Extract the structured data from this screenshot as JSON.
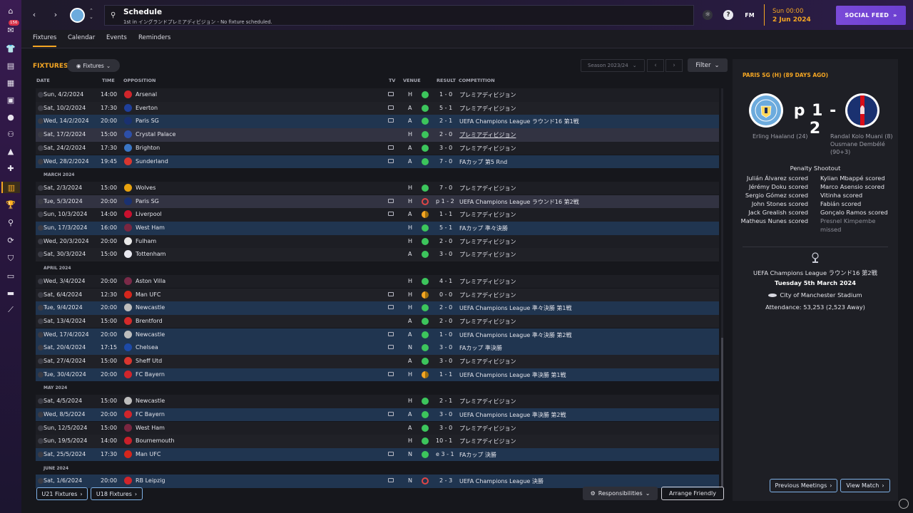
{
  "sidebar": {
    "badge_count": "156",
    "icons": [
      "home-icon",
      "inbox-icon",
      "squad-icon",
      "clipboard-icon",
      "report-icon",
      "coach-icon",
      "staff-icon",
      "training-icon",
      "medical-icon",
      "schedule-icon",
      "trophy-icon",
      "scouting-icon",
      "transfers-icon",
      "club-vision-icon",
      "finances-icon",
      "dev-centre-icon",
      "data-hub-icon"
    ]
  },
  "header": {
    "title": "Schedule",
    "subtitle": "1st in イングランドプレミアディビジョン - No fixture scheduled.",
    "game_time": "Sun 00:00",
    "game_date": "2 Jun 2024",
    "social_feed_label": "SOCIAL FEED",
    "fm_label": "FM"
  },
  "tabs": [
    "Fixtures",
    "Calendar",
    "Events",
    "Reminders"
  ],
  "fixtures": {
    "heading": "FIXTURES",
    "view_dropdown": "Fixtures",
    "season": "Season 2023/24",
    "filter_label": "Filter",
    "columns": {
      "date": "DATE",
      "time": "TIME",
      "opposition": "OPPOSITION",
      "tv": "TV",
      "venue": "VENUE",
      "result": "RESULT",
      "competition": "COMPETITION"
    },
    "rows": [
      {
        "kind": "match",
        "date": "Sun, 4/2/2024",
        "time": "14:00",
        "opp": "Arsenal",
        "crest": "#d0252b",
        "tv": true,
        "venue": "H",
        "res": "W",
        "score": "1 - 0",
        "comp": "プレミアディビジョン",
        "style": "even"
      },
      {
        "kind": "match",
        "date": "Sat, 10/2/2024",
        "time": "17:30",
        "opp": "Everton",
        "crest": "#1f3f9a",
        "tv": true,
        "venue": "A",
        "res": "W",
        "score": "5 - 1",
        "comp": "プレミアディビジョン",
        "style": "odd"
      },
      {
        "kind": "match",
        "date": "Wed, 14/2/2024",
        "time": "20:00",
        "opp": "Paris SG",
        "crest": "#1a3170",
        "tv": true,
        "venue": "A",
        "res": "W",
        "score": "2 - 1",
        "comp": "UEFA Champions League ラウンド16 第1戦",
        "style": "hl"
      },
      {
        "kind": "match",
        "date": "Sat, 17/2/2024",
        "time": "15:00",
        "opp": "Crystal Palace",
        "crest": "#2d4fa8",
        "tv": false,
        "venue": "H",
        "res": "W",
        "score": "2 - 0",
        "comp": "プレミアディビジョン",
        "style": "sel",
        "underline": true
      },
      {
        "kind": "match",
        "date": "Sat, 24/2/2024",
        "time": "17:30",
        "opp": "Brighton",
        "crest": "#3a75c4",
        "tv": true,
        "venue": "A",
        "res": "W",
        "score": "3 - 0",
        "comp": "プレミアディビジョン",
        "style": "even"
      },
      {
        "kind": "match",
        "date": "Wed, 28/2/2024",
        "time": "19:45",
        "opp": "Sunderland",
        "crest": "#d9362f",
        "tv": true,
        "venue": "A",
        "res": "W",
        "score": "7 - 0",
        "comp": "FAカップ 第5 Rnd",
        "style": "hl"
      },
      {
        "kind": "month",
        "label": "MARCH 2024"
      },
      {
        "kind": "match",
        "date": "Sat, 2/3/2024",
        "time": "15:00",
        "opp": "Wolves",
        "crest": "#e8a20e",
        "tv": false,
        "venue": "H",
        "res": "W",
        "score": "7 - 0",
        "comp": "プレミアディビジョン",
        "style": "even"
      },
      {
        "kind": "match",
        "date": "Tue, 5/3/2024",
        "time": "20:00",
        "opp": "Paris SG",
        "crest": "#1a3170",
        "tv": true,
        "venue": "H",
        "res": "L",
        "score": "p 1 - 2",
        "comp": "UEFA Champions League ラウンド16 第2戦",
        "style": "sel"
      },
      {
        "kind": "match",
        "date": "Sun, 10/3/2024",
        "time": "14:00",
        "opp": "Liverpool",
        "crest": "#c8102e",
        "tv": true,
        "venue": "A",
        "res": "D",
        "score": "1 - 1",
        "comp": "プレミアディビジョン",
        "style": "even"
      },
      {
        "kind": "match",
        "date": "Sun, 17/3/2024",
        "time": "16:00",
        "opp": "West Ham",
        "crest": "#7a2640",
        "tv": false,
        "venue": "H",
        "res": "W",
        "score": "5 - 1",
        "comp": "FAカップ 準々決勝",
        "style": "hl"
      },
      {
        "kind": "match",
        "date": "Wed, 20/3/2024",
        "time": "20:00",
        "opp": "Fulham",
        "crest": "#e8e8e8",
        "tv": false,
        "venue": "H",
        "res": "W",
        "score": "2 - 0",
        "comp": "プレミアディビジョン",
        "style": "even"
      },
      {
        "kind": "match",
        "date": "Sat, 30/3/2024",
        "time": "15:00",
        "opp": "Tottenham",
        "crest": "#e8e8f0",
        "tv": false,
        "venue": "A",
        "res": "W",
        "score": "3 - 0",
        "comp": "プレミアディビジョン",
        "style": "odd"
      },
      {
        "kind": "month",
        "label": "APRIL 2024"
      },
      {
        "kind": "match",
        "date": "Wed, 3/4/2024",
        "time": "20:00",
        "opp": "Aston Villa",
        "crest": "#7a2a48",
        "tv": false,
        "venue": "H",
        "res": "W",
        "score": "4 - 1",
        "comp": "プレミアディビジョン",
        "style": "even"
      },
      {
        "kind": "match",
        "date": "Sat, 6/4/2024",
        "time": "12:30",
        "opp": "Man UFC",
        "crest": "#d4261c",
        "tv": true,
        "venue": "H",
        "res": "D",
        "score": "0 - 0",
        "comp": "プレミアディビジョン",
        "style": "odd"
      },
      {
        "kind": "match",
        "date": "Tue, 9/4/2024",
        "time": "20:00",
        "opp": "Newcastle",
        "crest": "#bdbdbd",
        "tv": true,
        "venue": "H",
        "res": "W",
        "score": "2 - 0",
        "comp": "UEFA Champions League 準々決勝 第1戦",
        "style": "hl"
      },
      {
        "kind": "match",
        "date": "Sat, 13/4/2024",
        "time": "15:00",
        "opp": "Brentford",
        "crest": "#d42a2a",
        "tv": false,
        "venue": "A",
        "res": "W",
        "score": "2 - 0",
        "comp": "プレミアディビジョン",
        "style": "odd"
      },
      {
        "kind": "match",
        "date": "Wed, 17/4/2024",
        "time": "20:00",
        "opp": "Newcastle",
        "crest": "#bdbdbd",
        "tv": true,
        "venue": "A",
        "res": "W",
        "score": "1 - 0",
        "comp": "UEFA Champions League 準々決勝 第2戦",
        "style": "hl"
      },
      {
        "kind": "match",
        "date": "Sat, 20/4/2024",
        "time": "17:15",
        "opp": "Chelsea",
        "crest": "#1d4aa8",
        "tv": true,
        "venue": "N",
        "res": "W",
        "score": "3 - 0",
        "comp": "FAカップ 準決勝",
        "style": "hl"
      },
      {
        "kind": "match",
        "date": "Sat, 27/4/2024",
        "time": "15:00",
        "opp": "Sheff Utd",
        "crest": "#d9362f",
        "tv": false,
        "venue": "A",
        "res": "W",
        "score": "3 - 0",
        "comp": "プレミアディビジョン",
        "style": "odd"
      },
      {
        "kind": "match",
        "date": "Tue, 30/4/2024",
        "time": "20:00",
        "opp": "FC Bayern",
        "crest": "#d0252b",
        "tv": true,
        "venue": "H",
        "res": "D",
        "score": "1 - 1",
        "comp": "UEFA Champions League 準決勝 第1戦",
        "style": "hl"
      },
      {
        "kind": "month",
        "label": "MAY 2024"
      },
      {
        "kind": "match",
        "date": "Sat, 4/5/2024",
        "time": "15:00",
        "opp": "Newcastle",
        "crest": "#bdbdbd",
        "tv": false,
        "venue": "H",
        "res": "W",
        "score": "2 - 1",
        "comp": "プレミアディビジョン",
        "style": "even"
      },
      {
        "kind": "match",
        "date": "Wed, 8/5/2024",
        "time": "20:00",
        "opp": "FC Bayern",
        "crest": "#d0252b",
        "tv": true,
        "venue": "A",
        "res": "W",
        "score": "3 - 0",
        "comp": "UEFA Champions League 準決勝 第2戦",
        "style": "hl"
      },
      {
        "kind": "match",
        "date": "Sun, 12/5/2024",
        "time": "15:00",
        "opp": "West Ham",
        "crest": "#7a2640",
        "tv": false,
        "venue": "A",
        "res": "W",
        "score": "3 - 0",
        "comp": "プレミアディビジョン",
        "style": "even"
      },
      {
        "kind": "match",
        "date": "Sun, 19/5/2024",
        "time": "14:00",
        "opp": "Bournemouth",
        "crest": "#c8202a",
        "tv": false,
        "venue": "H",
        "res": "W",
        "score": "10 - 1",
        "comp": "プレミアディビジョン",
        "style": "odd"
      },
      {
        "kind": "match",
        "date": "Sat, 25/5/2024",
        "time": "17:30",
        "opp": "Man UFC",
        "crest": "#d4261c",
        "tv": true,
        "venue": "N",
        "res": "W",
        "score": "e 3 - 1",
        "comp": "FAカップ 決勝",
        "style": "hl"
      },
      {
        "kind": "month",
        "label": "JUNE 2024"
      },
      {
        "kind": "match",
        "date": "Sat, 1/6/2024",
        "time": "20:00",
        "opp": "RB Leipzig",
        "crest": "#d0252b",
        "tv": true,
        "venue": "N",
        "res": "L",
        "score": "2 - 3",
        "comp": "UEFA Champions League 決勝",
        "style": "hl"
      }
    ],
    "u21_label": "U21 Fixtures",
    "u18_label": "U18 Fixtures",
    "responsibilities_label": "Responsibilities",
    "arrange_friendly_label": "Arrange Friendly"
  },
  "match_panel": {
    "title": "PARIS SG (H) (89 DAYS AGO)",
    "score": "p 1 - 2",
    "home_crest_label": "MANCHESTER CITY",
    "away_crest_label": "PARIS",
    "home_scorers": [
      "Erling Haaland (24)"
    ],
    "away_scorers": [
      "Randal Kolo Muani (8)",
      "Ousmane Dembélé",
      "(90+3)"
    ],
    "penalty_heading": "Penalty Shootout",
    "penalties_home": [
      "Julián Álvarez scored",
      "Jérémy Doku scored",
      "Sergio Gómez scored",
      "John Stones scored",
      "Jack Grealish scored",
      "Matheus Nunes scored"
    ],
    "penalties_away": [
      "Kylian Mbappé scored",
      "Marco Asensio scored",
      "Vitinha scored",
      "Fabián scored",
      "Gonçalo Ramos scored",
      "Presnel Kimpembe",
      "missed"
    ],
    "competition": "UEFA Champions League ラウンド16 第2戦",
    "date": "Tuesday 5th March 2024",
    "stadium": "City of Manchester Stadium",
    "attendance": "Attendance: 53,253 (2,523 Away)",
    "previous_meetings_label": "Previous Meetings",
    "view_match_label": "View Match"
  },
  "colors": {
    "accent": "#f5a623",
    "win": "#3cc55c",
    "loss": "#e04646",
    "highlight_row": "#203550",
    "social": "#7a4ad8"
  }
}
